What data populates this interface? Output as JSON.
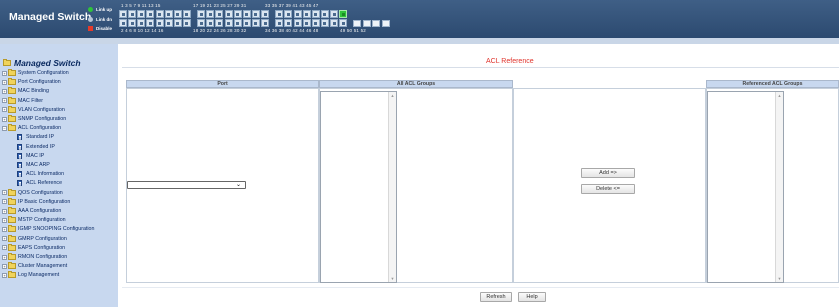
{
  "header": {
    "brand": "Managed Switch",
    "legend": {
      "link_up": "Link up",
      "link_dn": "Link dn",
      "disable": "Disable"
    },
    "port_numbers": {
      "odd_g1": "1  3  5  7  9  11  13  15",
      "odd_g2": "17  19  21  23  25  27  29  31",
      "odd_g3": "33  35  37  39  41  43  45  47",
      "even_g1": "2  4  6  8  10  12  14  16",
      "even_g2": "18  20  22  24  26  28  30  32",
      "even_g3": "34  36  38  40  42  44  46  48",
      "sfp": "49  50  51  52"
    },
    "colors": {
      "header_bg": "#2c4a70",
      "link_up": "#2fc43a",
      "disable": "#e53a2a"
    }
  },
  "sidebar": {
    "title": "Managed Switch",
    "items": [
      {
        "label": "System Configuration",
        "type": "folder",
        "expanded": false
      },
      {
        "label": "Port Configuration",
        "type": "folder",
        "expanded": false
      },
      {
        "label": "MAC Binding",
        "type": "folder",
        "expanded": false
      },
      {
        "label": "MAC Filter",
        "type": "folder",
        "expanded": false
      },
      {
        "label": "VLAN Configuration",
        "type": "folder",
        "expanded": false
      },
      {
        "label": "SNMP Configuration",
        "type": "folder",
        "expanded": false
      },
      {
        "label": "ACL Configuration",
        "type": "folder",
        "expanded": true
      },
      {
        "label": "Standard IP",
        "type": "page"
      },
      {
        "label": "Extended IP",
        "type": "page"
      },
      {
        "label": "MAC IP",
        "type": "page"
      },
      {
        "label": "MAC ARP",
        "type": "page"
      },
      {
        "label": "ACL Information",
        "type": "page"
      },
      {
        "label": "ACL Reference",
        "type": "page"
      },
      {
        "label": "QOS Configuration",
        "type": "folder",
        "expanded": false
      },
      {
        "label": "IP Basic Configuration",
        "type": "folder",
        "expanded": false
      },
      {
        "label": "AAA Configuration",
        "type": "folder",
        "expanded": false
      },
      {
        "label": "MSTP Configuration",
        "type": "folder",
        "expanded": false
      },
      {
        "label": "IGMP SNOOPING Configuration",
        "type": "folder",
        "expanded": false
      },
      {
        "label": "GMRP Configuration",
        "type": "folder",
        "expanded": false
      },
      {
        "label": "EAPS Configuration",
        "type": "folder",
        "expanded": false
      },
      {
        "label": "RMON Configuration",
        "type": "folder",
        "expanded": false
      },
      {
        "label": "Cluster Management",
        "type": "folder",
        "expanded": false
      },
      {
        "label": "Log Management",
        "type": "folder",
        "expanded": false
      }
    ]
  },
  "main": {
    "title": "ACL Reference",
    "columns": {
      "port": "Port",
      "all_groups": "All ACL Groups",
      "referenced": "Referenced ACL Groups"
    },
    "port_select_value": "",
    "buttons": {
      "add": "Add =>",
      "delete": "Delete <=",
      "refresh": "Refresh",
      "help": "Help"
    },
    "colors": {
      "title": "#e0332b",
      "table_header_bg": "#c8d8ef"
    }
  }
}
